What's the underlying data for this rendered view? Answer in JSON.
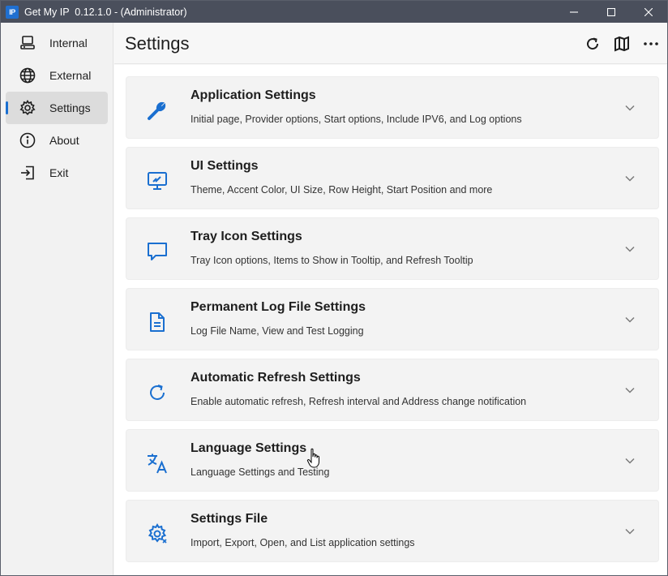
{
  "titlebar": {
    "app_icon_text": "IP",
    "title": "Get My IP  0.12.1.0 - (Administrator)",
    "controls": [
      "minimize-icon",
      "maximize-icon",
      "close-icon"
    ]
  },
  "sidebar": {
    "items": [
      {
        "label": "Internal",
        "icon": "computer-icon"
      },
      {
        "label": "External",
        "icon": "globe-icon"
      },
      {
        "label": "Settings",
        "icon": "gear-icon",
        "selected": true
      },
      {
        "label": "About",
        "icon": "info-icon"
      },
      {
        "label": "Exit",
        "icon": "exit-icon"
      }
    ]
  },
  "header": {
    "title": "Settings",
    "actions": [
      "refresh-icon",
      "map-icon",
      "more-icon"
    ]
  },
  "cards": [
    {
      "title": "Application Settings",
      "desc": "Initial page, Provider options, Start options, Include IPV6, and Log options",
      "icon": "wrench-icon"
    },
    {
      "title": "UI Settings",
      "desc": "Theme, Accent Color, UI Size, Row Height, Start Position and more",
      "icon": "monitor-icon"
    },
    {
      "title": "Tray Icon Settings",
      "desc": "Tray Icon options, Items to Show in Tooltip, and Refresh Tooltip",
      "icon": "speech-bubble-icon"
    },
    {
      "title": "Permanent Log File Settings",
      "desc": "Log File Name, View and Test Logging",
      "icon": "document-icon"
    },
    {
      "title": "Automatic Refresh Settings",
      "desc": "Enable automatic refresh, Refresh interval and Address change notification",
      "icon": "refresh-icon"
    },
    {
      "title": "Language Settings",
      "desc": "Language Settings and Testing",
      "icon": "translate-icon"
    },
    {
      "title": "Settings File",
      "desc": "Import, Export, Open, and List application settings",
      "icon": "settings-file-icon"
    }
  ],
  "colors": {
    "accent": "#1a6fd0",
    "titlebar": "#4a4f5c",
    "card_bg": "#f3f3f3",
    "sidebar_selected": "#dcdcdc"
  }
}
